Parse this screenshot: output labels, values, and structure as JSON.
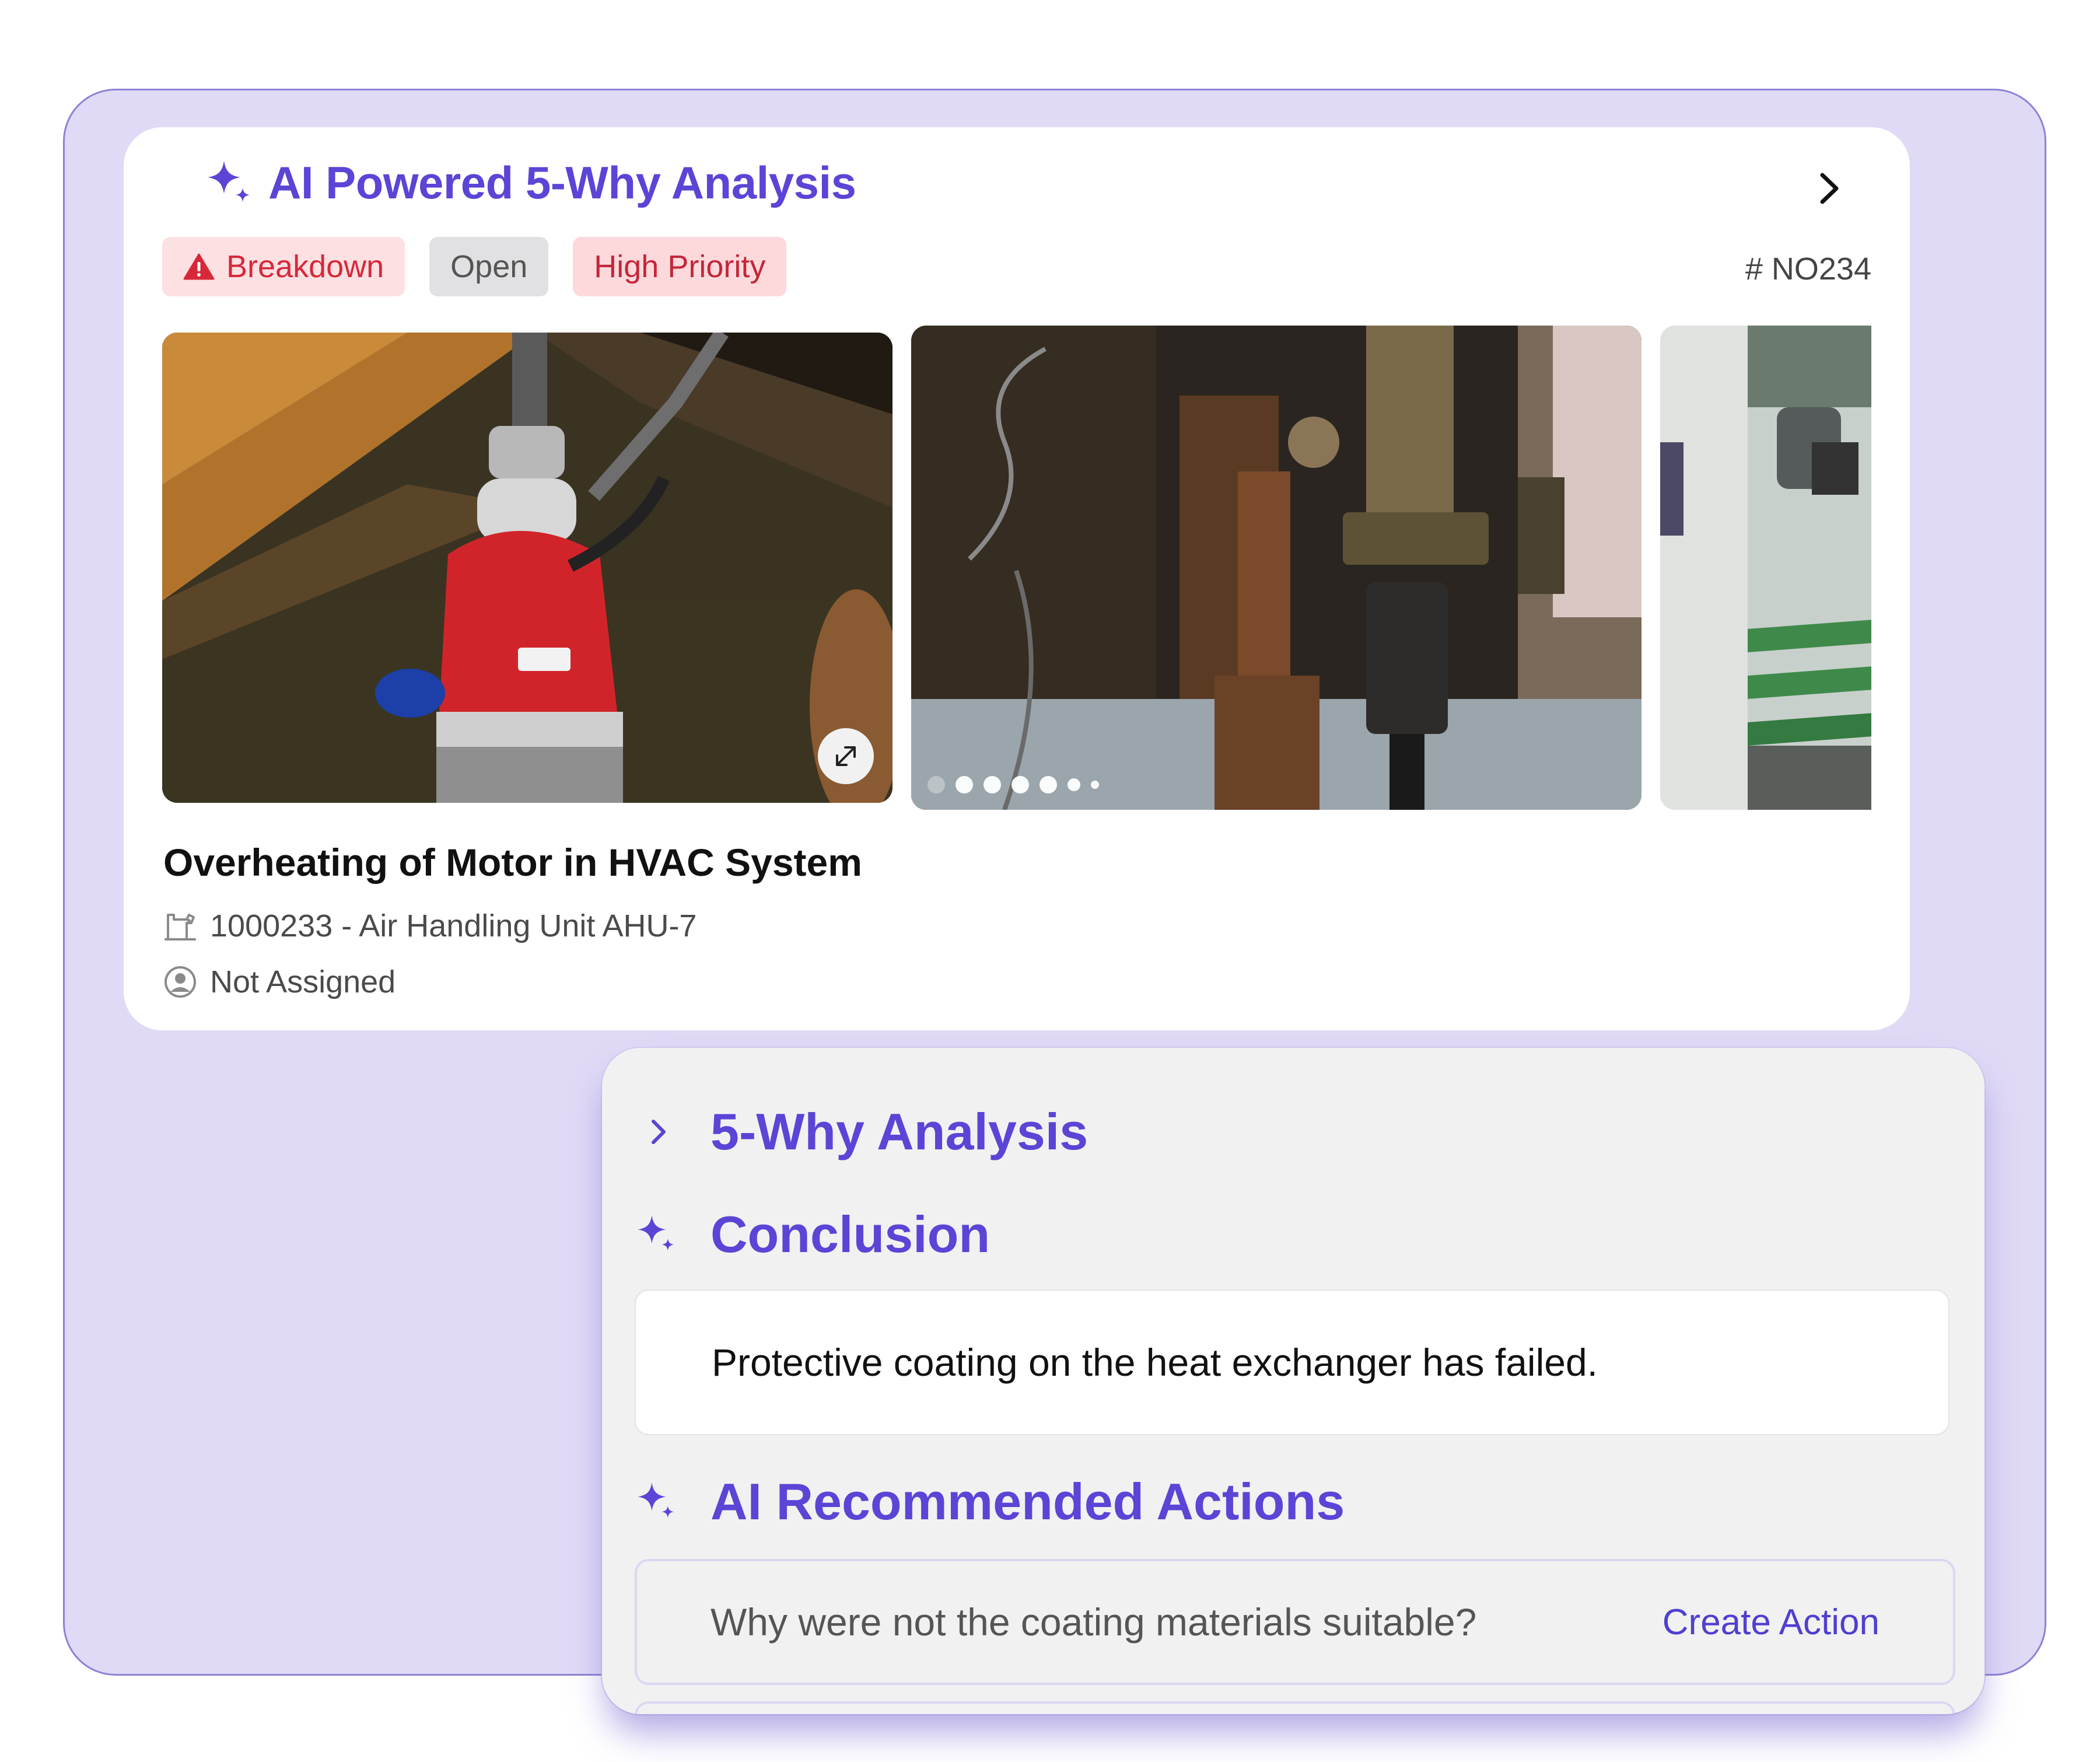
{
  "card": {
    "title": "AI Powered 5-Why Analysis",
    "ticket_id": "# NO234",
    "badges": {
      "type": "Breakdown",
      "status": "Open",
      "priority": "High Priority"
    },
    "issue_title": "Overheating of Motor in HVAC System",
    "asset": "1000233 - Air Handling Unit AHU-7",
    "assignee": "Not Assigned",
    "carousel": {
      "image_count": 6,
      "active_index": 0
    }
  },
  "panel": {
    "why_section_title": "5-Why Analysis",
    "conclusion_title": "Conclusion",
    "conclusion_text": "Protective coating on the heat exchanger has failed.",
    "recommended_title": "AI Recommended Actions",
    "actions": [
      {
        "question": "Why were not the coating materials suitable?",
        "button": "Create Action"
      }
    ]
  },
  "colors": {
    "accent": "#5a45d6",
    "frame_bg": "#e0daf6",
    "danger": "#d7283a",
    "danger_bg": "#fde0e2"
  },
  "icons": [
    "sparkle-icon",
    "chevron-right-icon",
    "warning-icon",
    "expand-icon",
    "machine-icon",
    "user-circle-icon"
  ]
}
